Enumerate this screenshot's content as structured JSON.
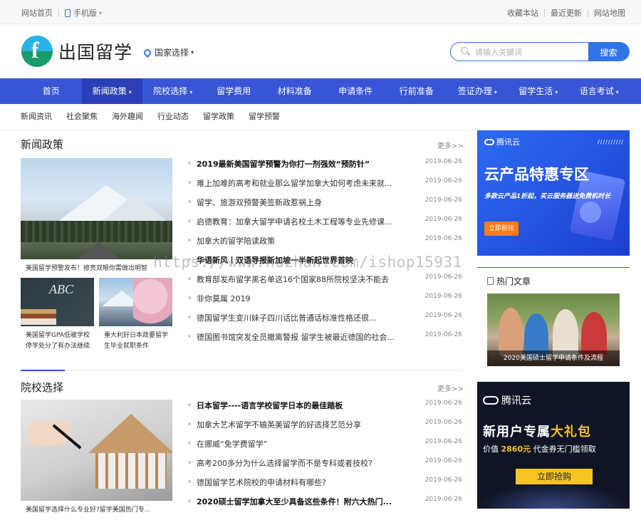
{
  "topbar": {
    "home": "网站首页",
    "mobile": "手机版",
    "favorite": "收藏本站",
    "recent": "最近更新",
    "sitemap": "网站地图"
  },
  "header": {
    "logo_text": "出国留学",
    "country_select": "国家选择",
    "search_placeholder": "请输入关键词",
    "search_button": "搜索"
  },
  "mainnav": [
    {
      "label": "首页",
      "dropdown": false,
      "active": false
    },
    {
      "label": "新闻政策",
      "dropdown": true,
      "active": true
    },
    {
      "label": "院校选择",
      "dropdown": true,
      "active": false
    },
    {
      "label": "留学费用",
      "dropdown": false,
      "active": false
    },
    {
      "label": "材料准备",
      "dropdown": false,
      "active": false
    },
    {
      "label": "申请条件",
      "dropdown": false,
      "active": false
    },
    {
      "label": "行前准备",
      "dropdown": false,
      "active": false
    },
    {
      "label": "签证办理",
      "dropdown": true,
      "active": false
    },
    {
      "label": "留学生活",
      "dropdown": true,
      "active": false
    },
    {
      "label": "语言考试",
      "dropdown": true,
      "active": false
    }
  ],
  "subnav": [
    "新闻资讯",
    "社会聚焦",
    "海外趣闻",
    "行业动态",
    "留学政策",
    "留学预警"
  ],
  "section1": {
    "title": "新闻政策",
    "more": "更多>>",
    "big_caption": "美国留学预警发布！擦亮双眼你需做出明智",
    "small1_caption": "美国留学GPA低被学校\n停学处分了有办法继续",
    "small2_caption": "重大利好日本政要留学\n生毕业就职条件",
    "items": [
      {
        "title": "2019最新美国留学预警为你打一剂强效“预防针”",
        "date": "2019-06-26",
        "bold": true
      },
      {
        "title": "难上加难的高考和就业那么留学加拿大如何考虑未来就...",
        "date": "2019-06-26",
        "bold": false
      },
      {
        "title": "留学、旅游双预警美签新政惹祸上身",
        "date": "2019-06-26",
        "bold": false
      },
      {
        "title": "启德教育：加拿大留学申请名校土木工程等专业先修课...",
        "date": "2019-06-26",
        "bold": false
      },
      {
        "title": "加拿大的留学陪读政策",
        "date": "2019-06-26",
        "bold": false
      },
      {
        "title": "华语新风丨双语导报新加坡一半新起世界首映",
        "date": "",
        "bold": true
      },
      {
        "title": "教育部发布留学黑名单这16个国家88所院校坚决不能去",
        "date": "2019-06-26",
        "bold": false
      },
      {
        "title": "非你莫属 2019",
        "date": "2019-06-26",
        "bold": false
      },
      {
        "title": "德国留学生变川妹子四川话比普通话标准性格还很...",
        "date": "2019-06-26",
        "bold": false
      },
      {
        "title": "德国图书馆突发全员撤离警报 留学生被最近德国的社会...",
        "date": "2019-06-26",
        "bold": false
      }
    ]
  },
  "section2": {
    "title": "院校选择",
    "more": "更多>>",
    "big_caption": "美国留学选择什么专业好?留学美国热门专...",
    "items": [
      {
        "title": "日本留学----语言学校留学日本的最佳踏板",
        "date": "2019-06-26",
        "bold": true
      },
      {
        "title": "加拿大艺术留学不输英美留学的好选择艺范分享",
        "date": "2019-06-26",
        "bold": false
      },
      {
        "title": "在挪威“免学费留学”",
        "date": "2019-06-26",
        "bold": false
      },
      {
        "title": "高考200多分为什么选择留学而不是专科或者技校?",
        "date": "2019-06-26",
        "bold": false
      },
      {
        "title": "德国留学艺术院校的申请材料有哪些?",
        "date": "2019-06-26",
        "bold": false
      },
      {
        "title": "2020硕士留学加拿大至少具备这些条件！附六大热门...",
        "date": "2019-06-26",
        "bold": true
      }
    ]
  },
  "ad1": {
    "brand": "腾讯云",
    "headline": "云产品特惠专区",
    "sub": "多款云产品1折起，买云服务器送免费机时长",
    "button": "立即前往"
  },
  "hot": {
    "title": "热门文章",
    "caption": "2020美国硕士留学申请条件及流程"
  },
  "ad2": {
    "brand": "腾讯云",
    "headline_a": "新用户专属",
    "headline_b": "大礼包",
    "sub_a": "价值",
    "sub_b": "2860元",
    "sub_c": "代金券无门槛领取",
    "button": "立即抢购"
  },
  "watermark": "https://www.huzhan.com/ishop15931",
  "colors": {
    "nav": "#3755d5",
    "nav_active": "#2a3fb8",
    "accent": "#2f74e8",
    "ad_yellow": "#f6c423"
  }
}
